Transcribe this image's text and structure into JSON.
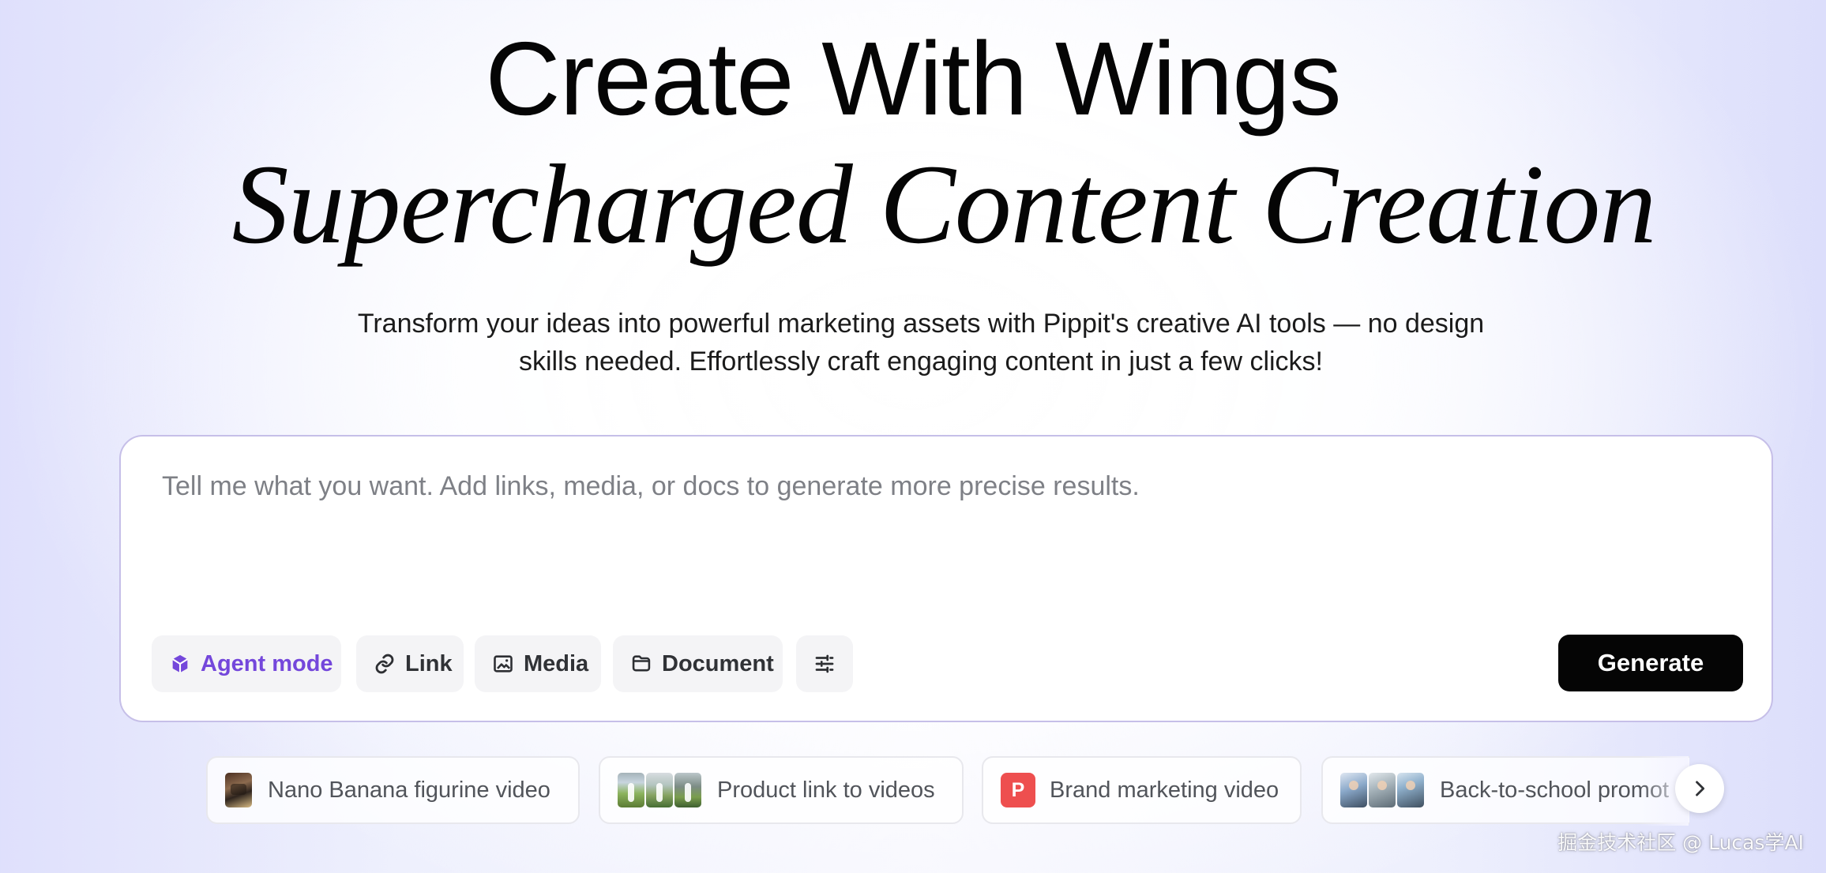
{
  "hero": {
    "title_line_1": "Create With Wings",
    "title_line_2": "Supercharged Content Creation",
    "subtitle_line_1": "Transform your ideas into powerful marketing assets with Pippit's creative AI tools — no design",
    "subtitle_line_2": "skills needed. Effortlessly craft engaging content in just a few clicks!"
  },
  "prompt": {
    "placeholder": "Tell me what you want. Add links, media, or docs to generate more precise results.",
    "value": ""
  },
  "toolbar": {
    "agent_mode_label": "Agent mode",
    "link_label": "Link",
    "media_label": "Media",
    "document_label": "Document",
    "generate_label": "Generate",
    "agent_icon": "cube-icon",
    "link_icon": "link-icon",
    "media_icon": "image-icon",
    "document_icon": "folder-icon",
    "settings_icon": "sliders-icon"
  },
  "suggestions": [
    {
      "label": "Nano Banana figurine video",
      "thumbnail": "figurine-thumbnail"
    },
    {
      "label": "Product link to videos",
      "thumbnail": "product-video-thumbnails"
    },
    {
      "label": "Brand marketing video",
      "thumbnail": "brand-p-logo",
      "logo_text": "P"
    },
    {
      "label": "Back-to-school promot",
      "thumbnail": "school-promo-thumbnails"
    }
  ],
  "carousel": {
    "next_icon": "chevron-right-icon"
  },
  "watermark": {
    "text": "掘金技术社区 @ Lucas学AI"
  },
  "colors": {
    "accent_purple": "#7447db",
    "generate_button": "#050505",
    "brand_logo_red": "#ee4f4f",
    "card_border": "#c6bfe8"
  }
}
